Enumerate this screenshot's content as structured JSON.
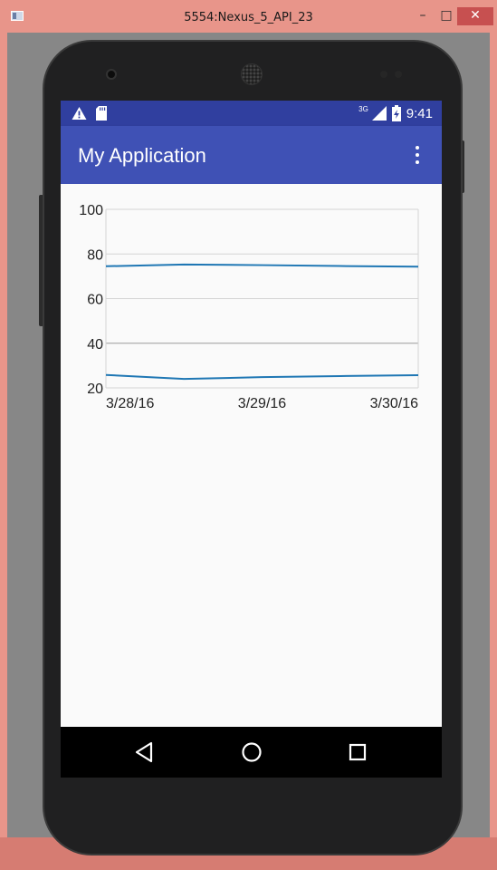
{
  "window": {
    "title": "5554:Nexus_5_API_23",
    "minimize": "–",
    "maximize": "□",
    "close": "✕"
  },
  "statusbar": {
    "icons": [
      "warning-icon",
      "sd-card-icon",
      "signal-icon",
      "battery-charging-icon"
    ],
    "network": "3G",
    "time": "9:41"
  },
  "appbar": {
    "title": "My Application",
    "menu_icon": "overflow-menu-icon"
  },
  "chart_data": {
    "type": "line",
    "title": "",
    "xlabel": "",
    "ylabel": "",
    "x": [
      "3/28/16",
      "3/28/16 12:00",
      "3/29/16",
      "3/29/16 12:00",
      "3/30/16"
    ],
    "xticks": [
      "3/28/16",
      "3/29/16",
      "3/30/16"
    ],
    "yticks": [
      "100",
      "80",
      "60",
      "40",
      "20"
    ],
    "ylim": [
      20,
      100
    ],
    "grid": true,
    "legend": false,
    "series": [
      {
        "values": [
          74.5,
          75.3,
          75.0,
          74.6,
          74.3
        ],
        "color": "#1f77b4"
      },
      {
        "values": [
          25.8,
          24.0,
          24.8,
          25.3,
          25.7
        ],
        "color": "#1f77b4"
      }
    ]
  },
  "navbar": {
    "back": "back-icon",
    "home": "home-icon",
    "recents": "recents-icon"
  }
}
